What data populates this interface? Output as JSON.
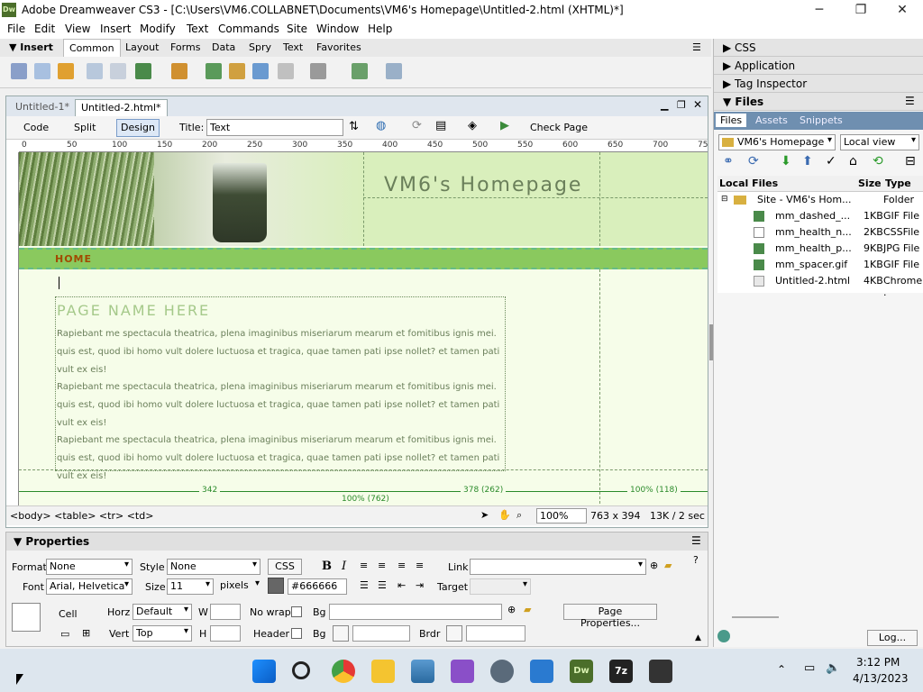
{
  "window": {
    "title": "Adobe Dreamweaver CS3 - [C:\\Users\\VM6.COLLABNET\\Documents\\VM6's Homepage\\Untitled-2.html (XHTML)*]",
    "app_icon": "Dw",
    "minimize": "─",
    "maximize": "❐",
    "close": "✕"
  },
  "menu": [
    "File",
    "Edit",
    "View",
    "Insert",
    "Modify",
    "Text",
    "Commands",
    "Site",
    "Window",
    "Help"
  ],
  "insert_panel": {
    "label": "Insert",
    "tabs": [
      "Common",
      "Layout",
      "Forms",
      "Data",
      "Spry",
      "Text",
      "Favorites"
    ],
    "active_tab": "Common"
  },
  "document": {
    "tabs": [
      "Untitled-1*",
      "Untitled-2.html*"
    ],
    "active_tab": "Untitled-2.html*",
    "view_buttons": {
      "code": "Code",
      "split": "Split",
      "design": "Design"
    },
    "title_label": "Title:",
    "title_value": "Text",
    "check_page": "Check Page",
    "ruler_marks": [
      "0",
      "50",
      "100",
      "150",
      "200",
      "250",
      "300",
      "350",
      "400",
      "450",
      "500",
      "550",
      "600",
      "650",
      "700",
      "75"
    ],
    "site_title": "VM6's Homepage",
    "nav_home": "HOME",
    "page_name": "PAGE NAME HERE",
    "paragraphs": [
      "Rapiebant me spectacula theatrica, plena imaginibus miseriarum mearum et fomitibus ignis mei. quis est, quod ibi homo vult dolere luctuosa et tragica, quae tamen pati ipse nollet? et tamen pati vult ex eis!",
      "Rapiebant me spectacula theatrica, plena imaginibus miseriarum mearum et fomitibus ignis mei. quis est, quod ibi homo vult dolere luctuosa et tragica, quae tamen pati ipse nollet? et tamen pati vult ex eis!",
      "Rapiebant me spectacula theatrica, plena imaginibus miseriarum mearum et fomitibus ignis mei. quis est, quod ibi homo vult dolere luctuosa et tragica, quae tamen pati ipse nollet? et tamen pati vult ex eis!"
    ],
    "table_widths": [
      "342",
      "378 (262)",
      "100% (118)",
      "100% (762)"
    ]
  },
  "status": {
    "tag_selector": "<body> <table> <tr> <td>",
    "zoom": "100%",
    "window_size": "763 x 394",
    "download": "13K / 2 sec"
  },
  "properties": {
    "title": "Properties",
    "format_label": "Format",
    "format_value": "None",
    "style_label": "Style",
    "style_value": "None",
    "css_button": "CSS",
    "bold": "B",
    "italic": "I",
    "link_label": "Link",
    "font_label": "Font",
    "font_value": "Arial, Helvetica",
    "size_label": "Size",
    "size_value": "11",
    "unit_value": "pixels",
    "color_value": "#666666",
    "target_label": "Target",
    "cell_label": "Cell",
    "horz_label": "Horz",
    "horz_value": "Default",
    "w_label": "W",
    "nowrap_label": "No wrap",
    "bg_label": "Bg",
    "page_properties": "Page Properties...",
    "vert_label": "Vert",
    "vert_value": "Top",
    "h_label": "H",
    "header_label": "Header",
    "brdr_label": "Brdr"
  },
  "right_panel": {
    "groups": [
      "CSS",
      "Application",
      "Tag Inspector",
      "Files"
    ],
    "file_tabs": [
      "Files",
      "Assets",
      "Snippets"
    ],
    "site_select": "VM6's Homepage",
    "view_select": "Local view",
    "columns": [
      "Local Files",
      "Size",
      "Type"
    ],
    "rows": [
      {
        "name": "Site - VM6's Hom...",
        "size": "",
        "type": "Folder"
      },
      {
        "name": "mm_dashed_...",
        "size": "1KB",
        "type": "GIF File"
      },
      {
        "name": "mm_health_n...",
        "size": "2KB",
        "type": "CSSFile"
      },
      {
        "name": "mm_health_p...",
        "size": "9KB",
        "type": "JPG File"
      },
      {
        "name": "mm_spacer.gif",
        "size": "1KB",
        "type": "GIF File"
      },
      {
        "name": "Untitled-2.html",
        "size": "4KB",
        "type": "Chrome ."
      }
    ],
    "log_button": "Log..."
  },
  "taskbar": {
    "time": "3:12 PM",
    "date": "4/13/2023",
    "apps": [
      "start-icon",
      "search-icon",
      "chrome-icon",
      "file-explorer-icon",
      "photos-icon",
      "visual-studio-icon",
      "settings-icon",
      "notepad-icon",
      "dreamweaver-icon",
      "7zip-icon",
      "terminal-icon"
    ]
  },
  "colors": {
    "banner": "#d9efbc",
    "nav": "#8ac95e",
    "canvas": "#f6fde9",
    "dw_green": "#4b6e2a"
  }
}
